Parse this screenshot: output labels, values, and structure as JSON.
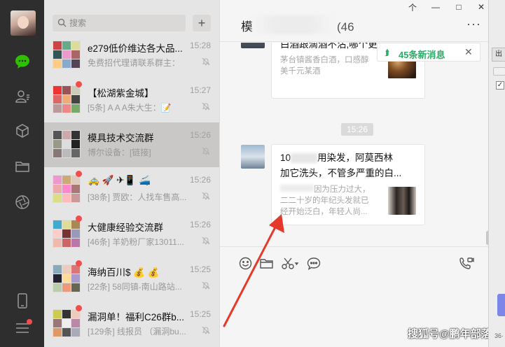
{
  "window": {
    "controls": [
      "个",
      "—",
      "□",
      "✕"
    ],
    "control_icons": [
      "pin-icon",
      "minimize-icon",
      "maximize-icon",
      "close-icon"
    ]
  },
  "rail": {
    "items": [
      "chat-icon",
      "contacts-icon",
      "favorites-icon",
      "files-icon",
      "moments-icon"
    ],
    "bottom": [
      "phone-icon",
      "menu-icon"
    ],
    "accent": "#2dc100"
  },
  "search": {
    "placeholder": "搜索",
    "add": "+"
  },
  "chats": [
    {
      "title": "e279低价维达各大品...",
      "time": "15:28",
      "preview": "免费招代理请联系群主：",
      "unread": false,
      "muted": true,
      "active": false
    },
    {
      "title": "【松湖紫金城】",
      "time": "15:27",
      "preview": "[5条] A A A朱大生：📝",
      "unread": true,
      "muted": true,
      "active": false
    },
    {
      "title": "模具技术交流群",
      "time": "15:26",
      "preview": "博尔设备：[链接]",
      "unread": false,
      "muted": true,
      "active": true
    },
    {
      "title": "🚕 🚀 ✈📱 🚄",
      "time": "15:26",
      "preview": "[38条] 贾欧：人找车售高...",
      "unread": true,
      "muted": true,
      "active": false
    },
    {
      "title": "大健康经验交流群",
      "time": "15:26",
      "preview": "[46条] 羊奶粉厂家13011...",
      "unread": true,
      "muted": true,
      "active": false
    },
    {
      "title": "海纳百川$ 💰 💰",
      "time": "15:25",
      "preview": "[22条] 58同镇-南山路站...",
      "unread": true,
      "muted": true,
      "active": false
    },
    {
      "title": "漏洞单！福利C26群b...",
      "time": "15:25",
      "preview": "[129条] 线报员 （漏洞bu...",
      "unread": true,
      "muted": true,
      "active": false
    }
  ],
  "conversation": {
    "title_visible": "模",
    "title_tail": "(46",
    "more": "···",
    "new_messages": "45条新消息",
    "new_messages_close": "✕",
    "time_divider": "15:26",
    "messages": [
      {
        "title": "白酒跟滴酒不沾,哪个更",
        "desc": [
          "茅台镇酱香白酒，口感醇",
          "美千元某酒"
        ]
      },
      {
        "title": [
          "10",
          "用染发，阿莫西林",
          "加它洗头，不管多严重的白..."
        ],
        "desc": [
          "因为压力过大，",
          "二二十岁的年纪头发就已",
          "经开始泛白，年轻人尚..."
        ]
      }
    ]
  },
  "composer": {
    "tools": [
      "emoji-icon",
      "folder-icon",
      "scissors-icon",
      "chat-bubble-icon"
    ],
    "call": "video-call-icon"
  },
  "watermark": {
    "text": "搜狐号@鹏年部落"
  },
  "side_panel": {
    "label": "出",
    "check": "✓",
    "tiny": "36·"
  },
  "annotation": {
    "color": "#e5392c"
  }
}
